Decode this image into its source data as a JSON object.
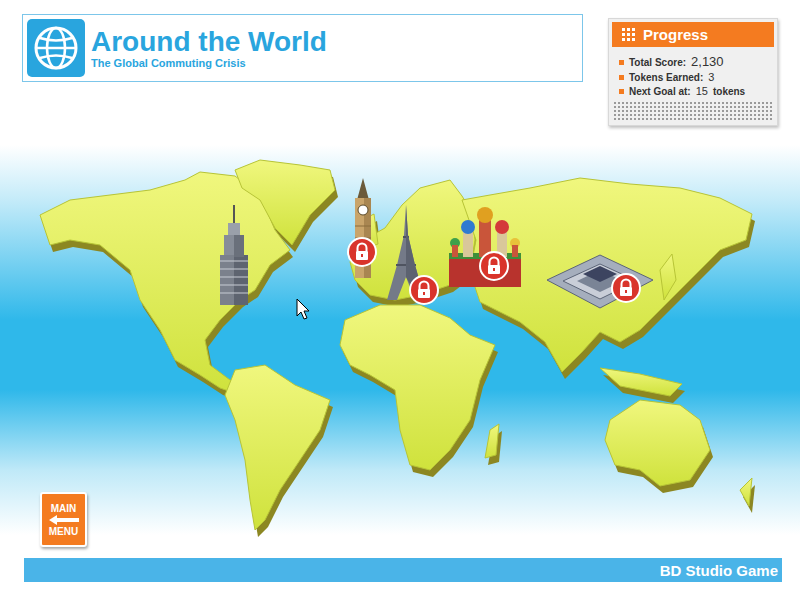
{
  "header": {
    "title": "Around the World",
    "subtitle": "The Global Commuting Crisis"
  },
  "progress": {
    "title": "Progress",
    "stats": [
      {
        "label": "Total Score:",
        "value": "2,130",
        "unit": ""
      },
      {
        "label": "Tokens Earned:",
        "value": "3",
        "unit": ""
      },
      {
        "label": "Next Goal at:",
        "value": "15",
        "unit": "tokens"
      }
    ]
  },
  "landmarks": [
    {
      "kind": "skyscraper",
      "locked": false
    },
    {
      "kind": "clock-tower",
      "locked": true
    },
    {
      "kind": "eiffel",
      "locked": true
    },
    {
      "kind": "onion-dome",
      "locked": true
    },
    {
      "kind": "palace",
      "locked": true
    }
  ],
  "main_menu": {
    "top": "MAIN",
    "bottom": "MENU"
  },
  "footer": {
    "brand": "BD Studio Game"
  }
}
